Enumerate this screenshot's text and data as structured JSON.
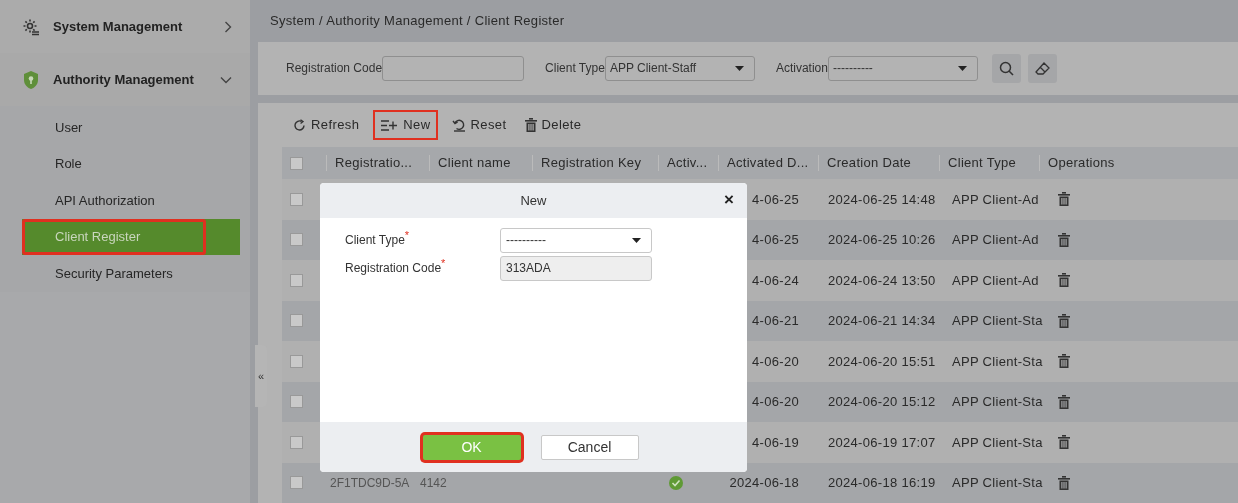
{
  "sidebar": {
    "groups": [
      {
        "label": "System Management",
        "kind": "gear",
        "expanded": false
      },
      {
        "label": "Authority Management",
        "kind": "shield",
        "expanded": true,
        "items": [
          {
            "label": "User",
            "selected": false,
            "highlighted": false
          },
          {
            "label": "Role",
            "selected": false,
            "highlighted": false
          },
          {
            "label": "API Authorization",
            "selected": false,
            "highlighted": false
          },
          {
            "label": "Client Register",
            "selected": true,
            "highlighted": true
          },
          {
            "label": "Security Parameters",
            "selected": false,
            "highlighted": false
          }
        ]
      }
    ],
    "collapse_handle": "«"
  },
  "breadcrumb": "System / Authority Management / Client Register",
  "filters": [
    {
      "label": "Registration Code",
      "kind": "text"
    },
    {
      "label": "Client Type",
      "kind": "select",
      "value": "APP Client-Staff"
    },
    {
      "label": "Activation",
      "kind": "select",
      "value": "----------"
    }
  ],
  "toolbar": [
    {
      "label": "Refresh",
      "kind": "refresh",
      "highlighted": false
    },
    {
      "label": "New",
      "kind": "new",
      "highlighted": true
    },
    {
      "label": "Reset",
      "kind": "reset",
      "highlighted": false
    },
    {
      "label": "Delete",
      "kind": "delete",
      "highlighted": false
    }
  ],
  "table": {
    "columns": [
      "Registratio...",
      "Client name",
      "Registration Key",
      "Activ...",
      "Activated D...",
      "Creation Date",
      "Client Type",
      "Operations"
    ],
    "header_checked": false,
    "rows": [
      {
        "checked": false,
        "activated_date": "4-06-25",
        "creation_date": "2024-06-25 14:48",
        "client_type": "APP Client-Ad"
      },
      {
        "checked": false,
        "activated_date": "4-06-25",
        "creation_date": "2024-06-25 10:26",
        "client_type": "APP Client-Ad"
      },
      {
        "checked": false,
        "activated_date": "4-06-24",
        "creation_date": "2024-06-24 13:50",
        "client_type": "APP Client-Ad"
      },
      {
        "checked": false,
        "activated_date": "4-06-21",
        "creation_date": "2024-06-21 14:34",
        "client_type": "APP Client-Sta"
      },
      {
        "checked": false,
        "activated_date": "4-06-20",
        "creation_date": "2024-06-20 15:51",
        "client_type": "APP Client-Sta"
      },
      {
        "checked": false,
        "activated_date": "4-06-20",
        "creation_date": "2024-06-20 15:12",
        "client_type": "APP Client-Sta"
      },
      {
        "checked": false,
        "activated_date": "4-06-19",
        "creation_date": "2024-06-19 17:07",
        "client_type": "APP Client-Sta"
      },
      {
        "checked": false,
        "registration_code": "2F1TDC9D-5A",
        "client_name": "4142",
        "activated": true,
        "activated_date": "2024-06-18",
        "creation_date": "2024-06-18 16:19",
        "client_type": "APP Client-Sta"
      }
    ]
  },
  "dialog": {
    "title": "New",
    "close": "×",
    "fields": [
      {
        "label": "Client Type$^{*}$",
        "kind": "select",
        "value": "----------"
      },
      {
        "label": "Registration Code$^{*}$",
        "kind": "text",
        "value": "313ADA",
        "disabled": true
      }
    ],
    "buttons": [
      {
        "label": "OK",
        "kind": "primary",
        "highlighted": true
      },
      {
        "label": "Cancel",
        "kind": "secondary",
        "highlighted": false
      }
    ]
  }
}
